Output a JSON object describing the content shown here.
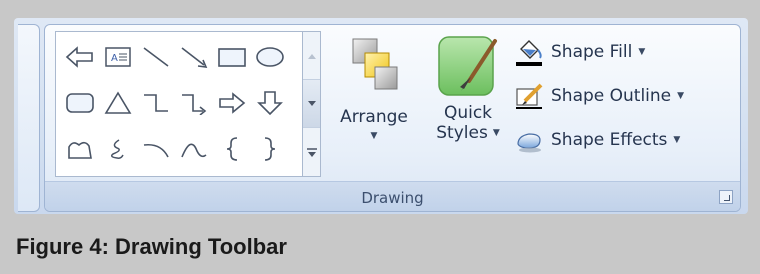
{
  "group": {
    "label": "Drawing"
  },
  "shapes_gallery": {
    "rows": [
      [
        "left-arrow-icon",
        "text-box-icon",
        "line-icon",
        "arrow-line-icon",
        "rectangle-icon",
        "oval-icon"
      ],
      [
        "rounded-rectangle-icon",
        "triangle-icon",
        "elbow-connector-icon",
        "elbow-arrow-connector-icon",
        "right-block-arrow-icon",
        "down-block-arrow-icon"
      ],
      [
        "freeform-icon",
        "scribble-icon",
        "arc-icon",
        "curve-icon",
        "left-brace-icon",
        "right-brace-icon"
      ]
    ]
  },
  "buttons": {
    "arrange": {
      "label": "Arrange"
    },
    "quick_styles": {
      "label_line1": "Quick",
      "label_line2": "Styles"
    },
    "shape_fill": {
      "label": "Shape Fill"
    },
    "shape_outline": {
      "label": "Shape Outline"
    },
    "shape_effects": {
      "label": "Shape Effects"
    }
  },
  "caption": "Figure 4: Drawing Toolbar",
  "colors": {
    "background": "#c8c8c8",
    "ribbon": "#dfe8f5",
    "quick_styles_green": "#8ccf7e",
    "fill_bucket_blue": "#4a7fc9"
  }
}
